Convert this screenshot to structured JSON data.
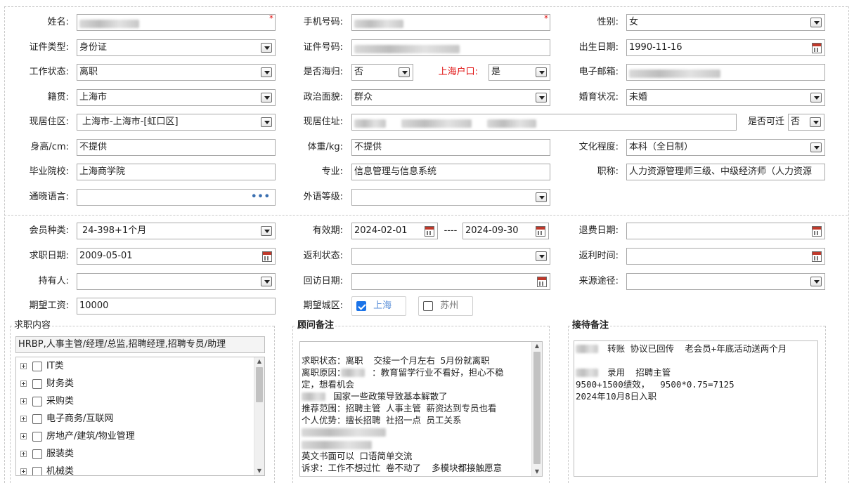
{
  "personal": {
    "name_label": "姓名:",
    "mobile_label": "手机号码:",
    "gender_label": "性别:",
    "gender_value": "女",
    "id_type_label": "证件类型:",
    "id_type_value": "身份证",
    "id_no_label": "证件号码:",
    "birth_label": "出生日期:",
    "birth_value": "1990-11-16",
    "work_status_label": "工作状态:",
    "work_status_value": "离职",
    "overseas_label": "是否海归:",
    "overseas_value": "否",
    "sh_hukou_label": "上海户口:",
    "sh_hukou_value": "是",
    "email_label": "电子邮箱:",
    "native_label": "籍贯:",
    "native_value": "上海市",
    "political_label": "政治面貌:",
    "political_value": "群众",
    "marital_label": "婚育状况:",
    "marital_value": "未婚",
    "district_label": "现居住区:",
    "district_value": "上海市-上海市-[虹口区]",
    "address_label": "现居住址:",
    "relocate_label": "是否可迁",
    "relocate_value": "否",
    "height_label": "身高/cm:",
    "height_value": "不提供",
    "weight_label": "体重/kg:",
    "weight_value": "不提供",
    "education_label": "文化程度:",
    "education_value": "本科（全日制）",
    "school_label": "毕业院校:",
    "school_value": "上海商学院",
    "major_label": "专业:",
    "major_value": "信息管理与信息系统",
    "title_label": "职称:",
    "title_value": "人力资源管理师三级、中级经济师（人力资源",
    "language_label": "通晓语言:",
    "language_more": "•••",
    "foreign_level_label": "外语等级:",
    "required_mark": "*"
  },
  "membership": {
    "type_label": "会员种类:",
    "type_value": "24-398+1个月",
    "valid_label": "有效期:",
    "valid_from": "2024-02-01",
    "valid_sep": "----",
    "valid_to": "2024-09-30",
    "refund_date_label": "退费日期:",
    "job_date_label": "求职日期:",
    "job_date_value": "2009-05-01",
    "rebate_status_label": "返利状态:",
    "rebate_time_label": "返利时间:",
    "holder_label": "持有人:",
    "visit_date_label": "回访日期:",
    "source_label": "来源途径:",
    "salary_label": "期望工资:",
    "salary_value": "10000",
    "city_label": "期望城区:",
    "city_options": [
      {
        "label": "上海",
        "checked": true
      },
      {
        "label": "苏州",
        "checked": false
      }
    ]
  },
  "job_content": {
    "legend": "求职内容",
    "summary": "HRBP,人事主管/经理/总监,招聘经理,招聘专员/助理",
    "categories": [
      "IT类",
      "财务类",
      "采购类",
      "电子商务/互联网",
      "房地产/建筑/物业管理",
      "服装类",
      "机械类"
    ]
  },
  "consultant_note": {
    "legend": "顾问备注",
    "lines": [
      "求职状态：离职  交接一个月左右 5月份就离职",
      "离职原因：     ：教育留学行业不看好，担心不稳",
      "定，想看机会",
      "      国家一些政策导致基本解散了",
      "推荐范围：招聘主管 人事主管 薪资达到专员也看",
      "个人优势：擅长招聘 社招一点 员工关系",
      "",
      "",
      "英文书面可以 口语简单交流",
      "诉求：工作不想过忙 卷不动了  多模块都接触愿意"
    ]
  },
  "reception_note": {
    "legend": "接待备注",
    "lines": [
      "      转账 协议已回传  老会员+年底活动送两个月",
      "",
      "      录用  招聘主管",
      "9500+1500绩效，  9500*0.75=7125",
      "2024年10月8日入职"
    ]
  }
}
